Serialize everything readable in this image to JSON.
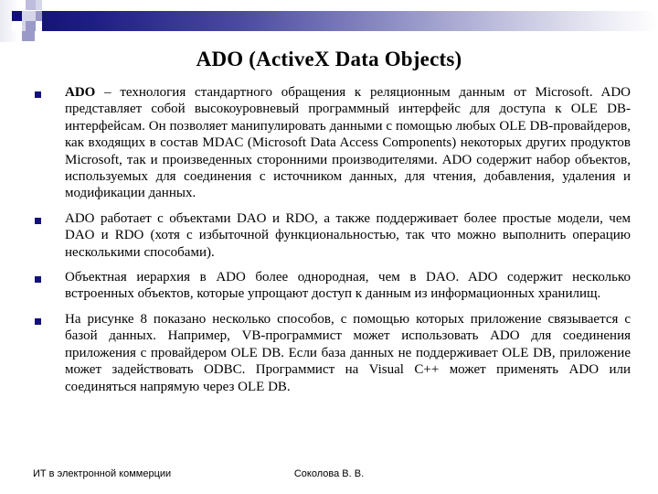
{
  "slide": {
    "title": "ADO (ActiveX Data Objects)",
    "bullets": [
      {
        "lead": "ADO",
        "text": " – технология стандартного обращения к реляционным данным от Microsoft. ADO представляет собой высокоуровневый программный интерфейс для доступа к OLE DB-интерфейсам. Он позволяет манипулировать данными с помощью любых OLE DB-провайдеров, как входящих в состав MDAC (Microsoft Data Access Components) некоторых других продуктов Microsoft, так и произведенных сторонними производителями. ADO содержит набор объектов, используемых для соединения с источником данных, для чтения, добавления, удаления и модификации данных."
      },
      {
        "lead": "",
        "text": "ADO работает с объектами DAO и RDO, а также поддерживает более простые модели, чем DAO и RDO (хотя с избыточной функциональностью, так что можно выполнить операцию несколькими способами)."
      },
      {
        "lead": "",
        "text": "Объектная иерархия в ADO более однородная, чем в DAO. ADO содержит несколько встроенных объектов, которые упрощают доступ к данным из информационных хранилищ."
      },
      {
        "lead": "",
        "text": "На рисунке 8 показано несколько способов, с помощью которых приложение связывается с базой данных. Например, VB-программист может использовать ADO для соединения приложения с провайдером OLE DB. Если база данных не поддерживает OLE DB, приложение может задействовать ODBC. Программист на Visual C++ может применять ADO или соединяться напрямую через OLE DB."
      }
    ]
  },
  "footer": {
    "left": "ИТ в электронной коммерции",
    "center": "Соколова В. В.",
    "right": ""
  },
  "theme": {
    "accent_dark": "#111179",
    "accent_mid": "#9a9ac8",
    "accent_light": "#bdbddd",
    "background": "#ffffff",
    "text": "#000000"
  }
}
